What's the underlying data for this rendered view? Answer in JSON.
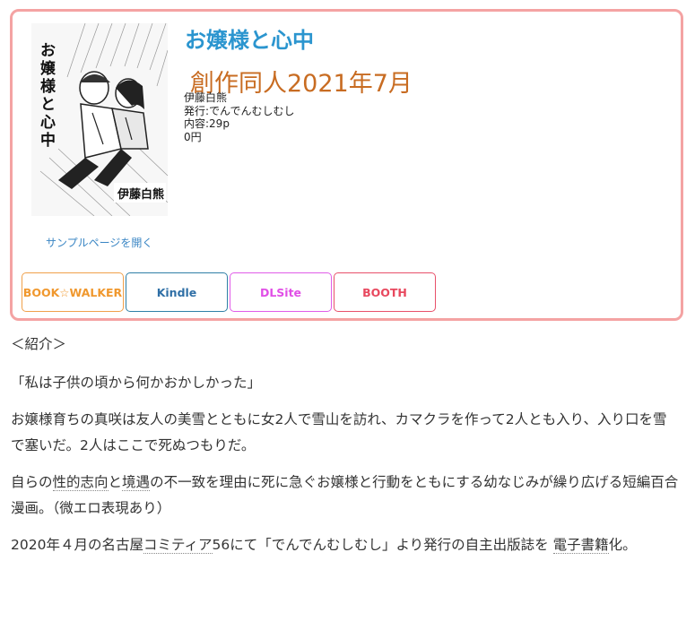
{
  "product": {
    "title": "お嬢様と心中",
    "category": "創作同人2021年7月",
    "author": "伊藤白熊",
    "publisher": "発行:でんでんむしむし",
    "pages": "内容:29p",
    "price": "0円",
    "sample_link": "サンプルページを開く",
    "cover": {
      "title": "お嬢様と心中",
      "author": "伊藤白熊"
    }
  },
  "stores": [
    {
      "label": "BOOK☆WALKER",
      "color": "#f0982e"
    },
    {
      "label": "Kindle",
      "color": "#2f6fa6"
    },
    {
      "label": "DLSite",
      "color": "#e04ee6"
    },
    {
      "label": "BOOTH",
      "color": "#e8485e"
    }
  ],
  "description": {
    "heading": "＜紹介＞",
    "quote": "「私は子供の頃から何かおかしかった」",
    "para1": "お嬢様育ちの真咲は友人の美雪とともに女2人で雪山を訪れ、カマクラを作って2人とも入り、入り口を雪で塞いだ。2人はここで死ぬつもりだ。",
    "para2_a": "自らの",
    "para2_link1": "性的志向",
    "para2_b": "と",
    "para2_link2": "境遇",
    "para2_c": "の不一致を理由に死に急ぐお嬢様と行動をともにする幼なじみが繰り広げる短編百合漫画。（微エロ表現あり）",
    "para3_a": "2020年４月の名古屋",
    "para3_link1": "コミティア",
    "para3_b": "56にて「でんでんむしむし」より発行の自主出版誌を ",
    "para3_link2": "電子書籍",
    "para3_c": "化。"
  }
}
